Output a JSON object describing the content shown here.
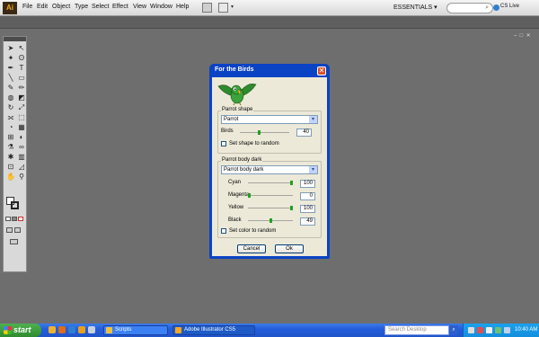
{
  "app": {
    "logo": "Ai",
    "menus": [
      "File",
      "Edit",
      "Object",
      "Type",
      "Select",
      "Effect",
      "View",
      "Window",
      "Help"
    ],
    "workspace": "ESSENTIALS",
    "cs_live": "CS Live"
  },
  "dialog": {
    "title": "For the Birds",
    "close": "✕",
    "shape_group": {
      "legend": "Parrot shape",
      "select_value": "Parrot",
      "birds_label": "Birds",
      "birds_value": "40",
      "birds_level": 0.4,
      "random_label": "Set shape to random",
      "random_checked": false
    },
    "color_group": {
      "legend": "Parrot body dark",
      "select_value": "Parrot body dark",
      "cyan_label": "Cyan",
      "cyan_value": "100",
      "magenta_label": "Magenta",
      "magenta_value": "0",
      "yellow_label": "Yellow",
      "yellow_value": "100",
      "black_label": "Black",
      "black_value": "49",
      "random_label": "Set color to random",
      "random_checked": false
    },
    "cancel_label": "Cancel",
    "ok_label": "Ok"
  },
  "taskbar": {
    "start_label": "start",
    "tasks": [
      "Scripts",
      "Adobe Illustrator CS5"
    ],
    "search_placeholder": "Search Desktop",
    "clock": "10:40 AM"
  },
  "colors": {
    "dialog_title": "#0a43c4",
    "slider_thumb": "#21a121",
    "parrot_body": "#2e8b2e",
    "taskbar": "#245edc"
  }
}
